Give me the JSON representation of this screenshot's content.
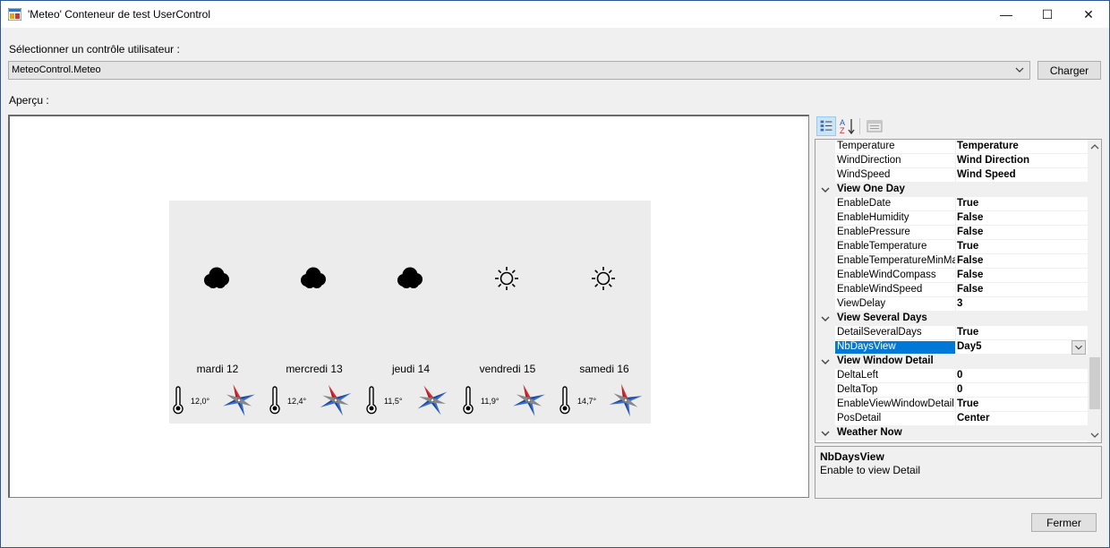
{
  "window": {
    "title": "'Meteo' Conteneur de test UserControl",
    "controls": {
      "minimize": "—",
      "maximize": "☐",
      "close": "✕"
    }
  },
  "select_label": "Sélectionner un contrôle utilisateur :",
  "control_combo": {
    "value": "MeteoControl.Meteo",
    "icon": "chevron-down-icon"
  },
  "load_button": "Charger",
  "preview_label": "Aperçu :",
  "forecast": [
    {
      "day": "mardi 12",
      "temp": "12,0°",
      "weather": "cloud",
      "wind_angle": -20
    },
    {
      "day": "mercredi 13",
      "temp": "12,4°",
      "weather": "cloud",
      "wind_angle": -25
    },
    {
      "day": "jeudi 14",
      "temp": "11,5°",
      "weather": "cloud",
      "wind_angle": -30
    },
    {
      "day": "vendredi 15",
      "temp": "11,9°",
      "weather": "sun",
      "wind_angle": -20
    },
    {
      "day": "samedi 16",
      "temp": "14,7°",
      "weather": "sun",
      "wind_angle": -15
    }
  ],
  "property_grid": {
    "toolbar": [
      "categorized-icon",
      "alphabetical-icon",
      "property-pages-icon"
    ],
    "rows": [
      {
        "type": "prop",
        "name": "Temperature",
        "value": "Temperature"
      },
      {
        "type": "prop",
        "name": "WindDirection",
        "value": "Wind Direction"
      },
      {
        "type": "prop",
        "name": "WindSpeed",
        "value": "Wind Speed"
      },
      {
        "type": "cat",
        "name": "View One Day"
      },
      {
        "type": "prop",
        "name": "EnableDate",
        "value": "True"
      },
      {
        "type": "prop",
        "name": "EnableHumidity",
        "value": "False"
      },
      {
        "type": "prop",
        "name": "EnablePressure",
        "value": "False"
      },
      {
        "type": "prop",
        "name": "EnableTemperature",
        "value": "True"
      },
      {
        "type": "prop",
        "name": "EnableTemperatureMinMa",
        "value": "False"
      },
      {
        "type": "prop",
        "name": "EnableWindCompass",
        "value": "False"
      },
      {
        "type": "prop",
        "name": "EnableWindSpeed",
        "value": "False"
      },
      {
        "type": "prop",
        "name": "ViewDelay",
        "value": "3"
      },
      {
        "type": "cat",
        "name": "View Several Days"
      },
      {
        "type": "prop",
        "name": "DetailSeveralDays",
        "value": "True"
      },
      {
        "type": "prop",
        "name": "NbDaysView",
        "value": "Day5",
        "selected": true
      },
      {
        "type": "cat",
        "name": "View Window Detail"
      },
      {
        "type": "prop",
        "name": "DeltaLeft",
        "value": "0"
      },
      {
        "type": "prop",
        "name": "DeltaTop",
        "value": "0"
      },
      {
        "type": "prop",
        "name": "EnableViewWindowDetail",
        "value": "True"
      },
      {
        "type": "prop",
        "name": "PosDetail",
        "value": "Center"
      },
      {
        "type": "cat",
        "name": "Weather Now"
      }
    ]
  },
  "description": {
    "title": "NbDaysView",
    "text": "Enable to view Detail"
  },
  "close_button": "Fermer",
  "colors": {
    "selection": "#0078d7",
    "window_border": "#2b5797",
    "compass_red": "#e0262b",
    "compass_blue": "#2f6fd6"
  }
}
